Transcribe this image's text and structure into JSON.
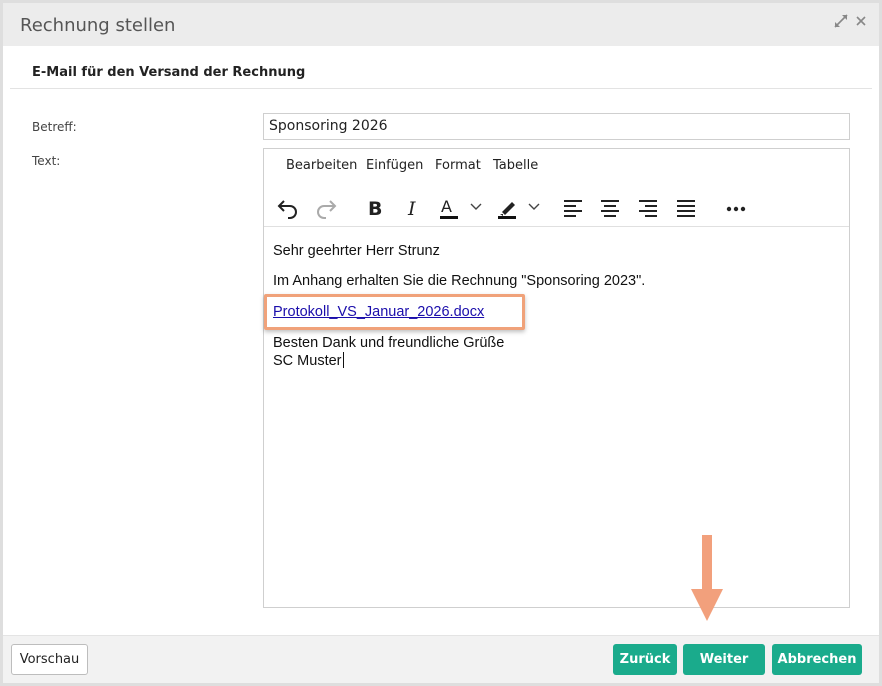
{
  "dialog": {
    "title": "Rechnung stellen",
    "section_title": "E-Mail für den Versand der Rechnung"
  },
  "form": {
    "subject_label": "Betreff:",
    "subject_value": "Sponsoring 2026",
    "text_label": "Text:"
  },
  "editor": {
    "menu": [
      "Bearbeiten",
      "Einfügen",
      "Format",
      "Tabelle"
    ],
    "toolbar_icons": [
      "undo-icon",
      "redo-icon",
      "bold-icon",
      "italic-icon",
      "text-color-icon",
      "highlight-color-icon",
      "align-left-icon",
      "align-center-icon",
      "align-right-icon",
      "align-justify-icon",
      "more-icon"
    ],
    "paragraphs": {
      "greeting": "Sehr geehrter Herr Strunz",
      "body": "Im Anhang erhalten Sie die Rechnung \"Sponsoring 2023\".",
      "attachment_link": "Protokoll_VS_Januar_2026.docx",
      "closing_line1": "Besten Dank und freundliche Grüße",
      "closing_line2": "SC Muster"
    }
  },
  "footer": {
    "preview_label": "Vorschau",
    "back_label": "Zurück",
    "next_label": "Weiter",
    "cancel_label": "Abbrechen"
  },
  "colors": {
    "primary": "#1aab8c",
    "annotation": "#f0a27a",
    "link": "#1a0dab"
  }
}
